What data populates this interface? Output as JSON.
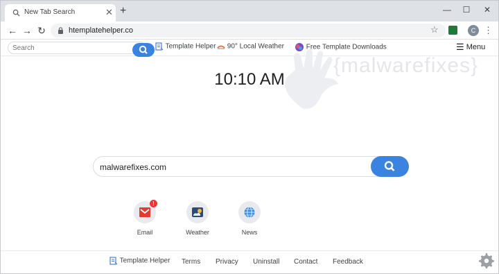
{
  "browser": {
    "tab_title": "New Tab Search",
    "tab_close": "✕",
    "new_tab": "+",
    "url": "htemplatehelper.co",
    "profile_initial": "C",
    "window_controls": [
      "—",
      "☐",
      "✕"
    ]
  },
  "header": {
    "search_placeholder": "Search",
    "links": [
      {
        "label": "Template Helper",
        "icon": "template-icon"
      },
      {
        "label": "90° Local Weather",
        "icon": "weather-icon"
      },
      {
        "label": "Free Template Downloads",
        "icon": "downloads-icon"
      }
    ],
    "menu_label": "Menu"
  },
  "watermark": "{malwarefixes}",
  "clock": "10:10 AM",
  "main_search": {
    "value": "malwarefixes.com"
  },
  "shortcuts": [
    {
      "label": "Email",
      "icon": "email-icon",
      "badge": "!"
    },
    {
      "label": "Weather",
      "icon": "weather-icon"
    },
    {
      "label": "News",
      "icon": "globe-icon"
    }
  ],
  "footer": {
    "links": [
      "Template Helper",
      "Terms",
      "Privacy",
      "Uninstall",
      "Contact",
      "Feedback"
    ]
  },
  "colors": {
    "accent": "#3b83e0",
    "badge": "#e53935"
  }
}
